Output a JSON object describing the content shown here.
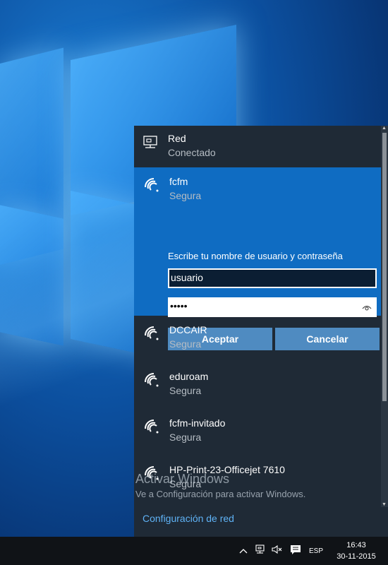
{
  "network_flyout": {
    "wired": {
      "name": "Red",
      "status": "Conectado"
    },
    "connecting": {
      "name": "fcfm",
      "security": "Segura",
      "prompt": "Escribe tu nombre de usuario y contraseña",
      "username_value": "usuario",
      "password_mask": "•••••",
      "accept_label": "Aceptar",
      "cancel_label": "Cancelar"
    },
    "networks": [
      {
        "name": "DCCAIR",
        "security": "Segura"
      },
      {
        "name": "eduroam",
        "security": "Segura"
      },
      {
        "name": "fcfm-invitado",
        "security": "Segura"
      },
      {
        "name": "HP-Print-23-Officejet 7610",
        "security": "Segura"
      }
    ],
    "settings_link": "Configuración de red"
  },
  "watermark": {
    "title": "Activar Windows",
    "subtitle": "Ve a Configuración para activar Windows."
  },
  "taskbar": {
    "language": "ESP",
    "time": "16:43",
    "date": "30-11-2015"
  },
  "colors": {
    "flyout_bg": "#1f2a36",
    "accent": "#0f6cc2",
    "link": "#5fb2f5"
  }
}
